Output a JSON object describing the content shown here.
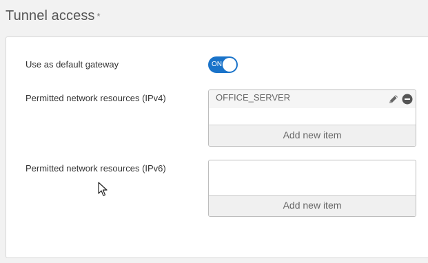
{
  "section": {
    "title": "Tunnel access",
    "required_mark": "*"
  },
  "default_gateway": {
    "label": "Use as default gateway",
    "toggle_state": "ON"
  },
  "ipv4": {
    "label": "Permitted network resources (IPv4)",
    "items": [
      "OFFICE_SERVER"
    ],
    "add_label": "Add new item"
  },
  "ipv6": {
    "label": "Permitted network resources (IPv6)",
    "items": [],
    "add_label": "Add new item"
  },
  "icons": {
    "edit": "pencil-icon",
    "remove": "minus-circle-icon",
    "cursor": "mouse-pointer-icon"
  },
  "colors": {
    "toggle_on": "#1a73c9",
    "panel_bg": "#ffffff",
    "page_bg": "#f2f2f2"
  }
}
